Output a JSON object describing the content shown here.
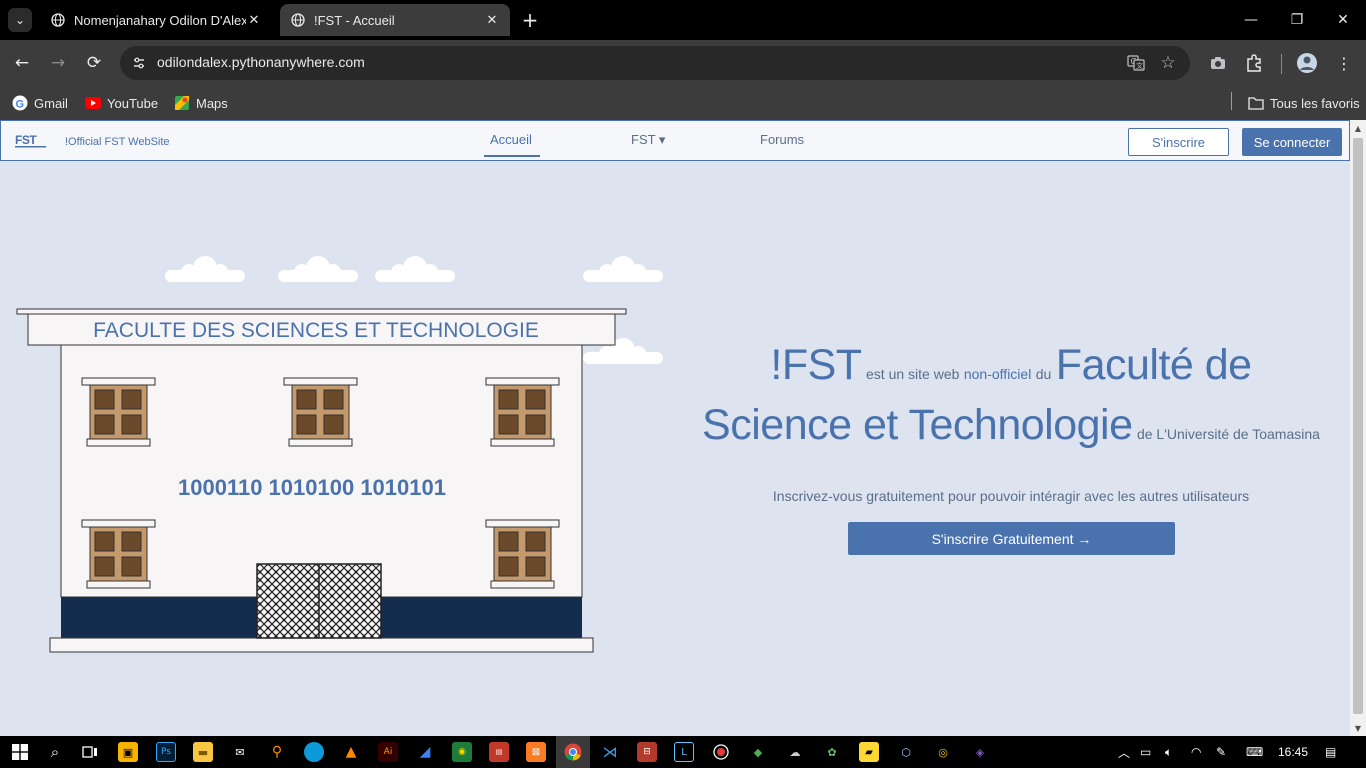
{
  "browser": {
    "tabs": [
      {
        "title": "Nomenjanahary Odilon D'Alex",
        "active": false
      },
      {
        "title": "!FST - Accueil",
        "active": true
      }
    ],
    "url": "odilondalex.pythonanywhere.com",
    "bookmarks": [
      {
        "label": "Gmail",
        "icon": "google-icon"
      },
      {
        "label": "YouTube",
        "icon": "youtube-icon"
      },
      {
        "label": "Maps",
        "icon": "maps-icon"
      }
    ],
    "all_bookmarks_label": "Tous les favoris"
  },
  "site": {
    "logo_text": "FST",
    "tagline": "!Official FST WebSite",
    "nav": [
      {
        "label": "Accueil",
        "active": true
      },
      {
        "label": "FST ▾",
        "active": false
      },
      {
        "label": "Forums",
        "active": false
      }
    ],
    "signup_label": "S'inscrire",
    "login_label": "Se connecter"
  },
  "illustration": {
    "building_sign": "FACULTE DES SCIENCES ET TECHNOLOGIE",
    "binary_text": "1000110 1010100 1010101"
  },
  "hero": {
    "brand": "!FST",
    "text1": "est un site web",
    "text2": "non-officiel",
    "text3": "du",
    "title_part1": "Faculté de",
    "title_part2": "Science et Technologie",
    "text4": "de L'Université de Toamasina",
    "subtitle": "Inscrivez-vous gratuitement pour pouvoir intéragir avec les autres utilisateurs",
    "cta_label": "S'inscrire Gratuitement →"
  },
  "colors": {
    "accent": "#4a72ad",
    "page_bg": "#dde3ef",
    "building_navy": "#142d4f",
    "window_brown": "#c49a6c"
  },
  "taskbar": {
    "clock": "16:45"
  }
}
